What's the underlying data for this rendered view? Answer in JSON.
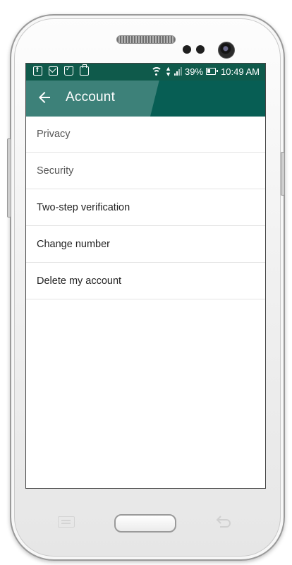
{
  "statusbar": {
    "notification_icons": [
      "facebook-icon",
      "gmail-icon",
      "shopping-bag-icon",
      "clipboard-icon"
    ],
    "battery_percent": "39%",
    "time": "10:49 AM"
  },
  "toolbar": {
    "title": "Account",
    "back_icon": "arrow-back-icon"
  },
  "settings": {
    "items": [
      {
        "label": "Privacy"
      },
      {
        "label": "Security"
      },
      {
        "label": "Two-step verification"
      },
      {
        "label": "Change number"
      },
      {
        "label": "Delete my account"
      }
    ]
  },
  "colors": {
    "status_bar": "#0f5a4b",
    "toolbar": "#075e54",
    "screen_background": "#ffffff",
    "divider": "#e3e3e3"
  }
}
